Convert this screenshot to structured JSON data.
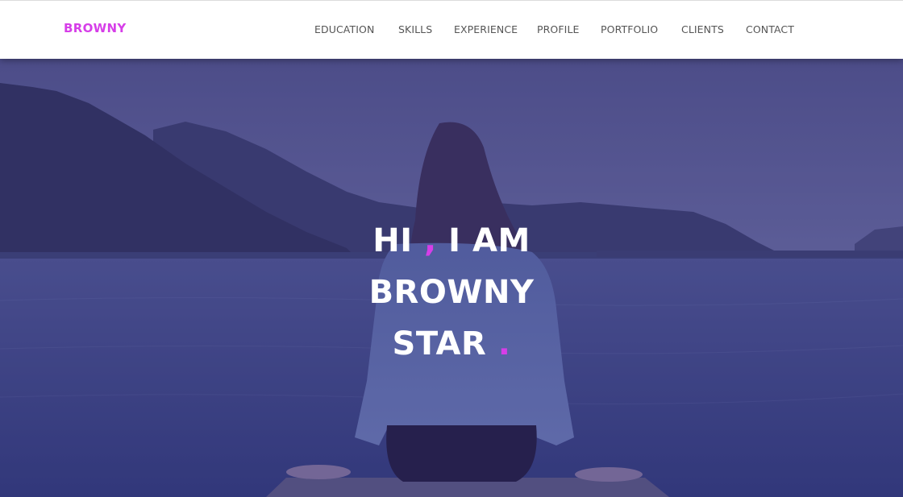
{
  "brand": {
    "name": "BROWNY",
    "color": "#d63ee8"
  },
  "nav": {
    "items": [
      {
        "label": "EDUCATION"
      },
      {
        "label": "SKILLS"
      },
      {
        "label": "EXPERIENCE"
      },
      {
        "label": "PROFILE"
      },
      {
        "label": "PORTFOLIO"
      },
      {
        "label": "CLIENTS"
      },
      {
        "label": "CONTACT"
      }
    ]
  },
  "hero": {
    "line1_a": "HI",
    "line1_comma": ",",
    "line1_b": "I AM",
    "line2": "BROWNY",
    "line3": "STAR",
    "line3_dot": ".",
    "accent_color": "#d63ee8"
  }
}
